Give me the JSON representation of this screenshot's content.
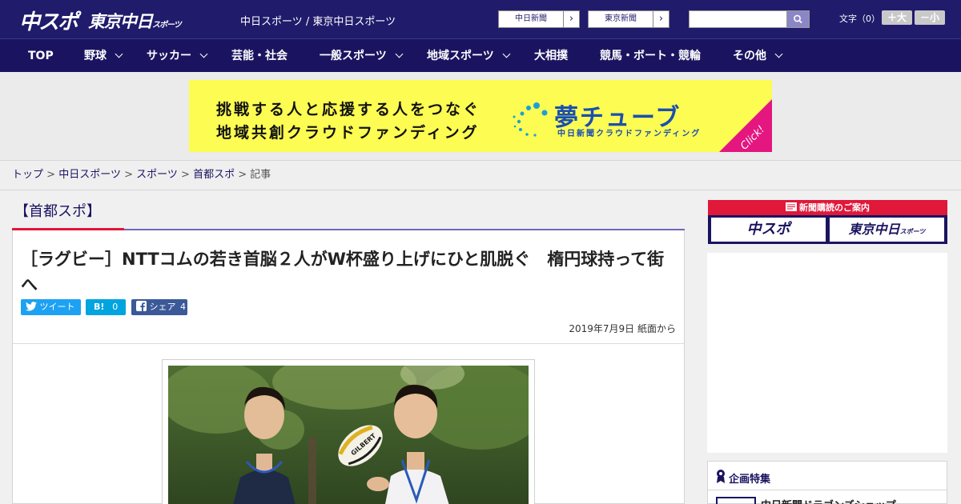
{
  "header": {
    "logo_chuspo": "中スポ",
    "logo_tokyo": "東京中日",
    "logo_tokyo_sub": "スポーツ",
    "site_title": "中日スポーツ / 東京中日スポーツ",
    "links": [
      {
        "label": "中日新聞"
      },
      {
        "label": "東京新聞"
      }
    ],
    "search": {
      "value": "",
      "placeholder": ""
    },
    "font_size_label": "文字（0）",
    "font_up": "＋大",
    "font_down": "－小"
  },
  "nav": {
    "items": [
      {
        "label": "TOP"
      },
      {
        "label": "野球"
      },
      {
        "label": "サッカー"
      },
      {
        "label": "芸能・社会"
      },
      {
        "label": "一般スポーツ"
      },
      {
        "label": "地域スポーツ"
      },
      {
        "label": "大相撲"
      },
      {
        "label": "競馬・ボート・競輪"
      },
      {
        "label": "その他"
      }
    ]
  },
  "banner": {
    "line1": "挑戦する人と応援する人をつなぐ",
    "line2": "地域共創クラウドファンディング",
    "brand": "夢チューブ",
    "brand_sub": "中日新聞クラウドファンディング",
    "click": "Click!"
  },
  "breadcrumb": {
    "items": [
      "トップ",
      "中日スポーツ",
      "スポーツ",
      "首都スポ"
    ],
    "current": "記事",
    "separator": ">"
  },
  "article": {
    "section": "【首都スポ】",
    "headline": "［ラグビー］NTTコムの若き首脳２人がW杯盛り上げにひと肌脱ぐ　楕円球持って街へ",
    "share": {
      "tweet": "ツイート",
      "hatena": "B!",
      "hatena_count": "0",
      "facebook": "シェア",
      "facebook_count": "4"
    },
    "date": "2019年7月9日 紙面から",
    "ball_text": "GILBERT"
  },
  "sidebar": {
    "subscription_head": "新聞購読のご案内",
    "subscription_logos": [
      "中スポ",
      "東京中日"
    ],
    "subscription_logo_sub": "スポーツ",
    "feature_title": "企画特集",
    "feature_item": "中日新聞ドラゴンズショップ"
  },
  "colors": {
    "brand_navy": "#201b6b",
    "accent_red": "#e0183a",
    "banner_yellow": "#fcfc52",
    "banner_pink": "#e4167f",
    "twitter": "#1da1f2",
    "hatena": "#00a4de",
    "facebook": "#3b5998"
  }
}
